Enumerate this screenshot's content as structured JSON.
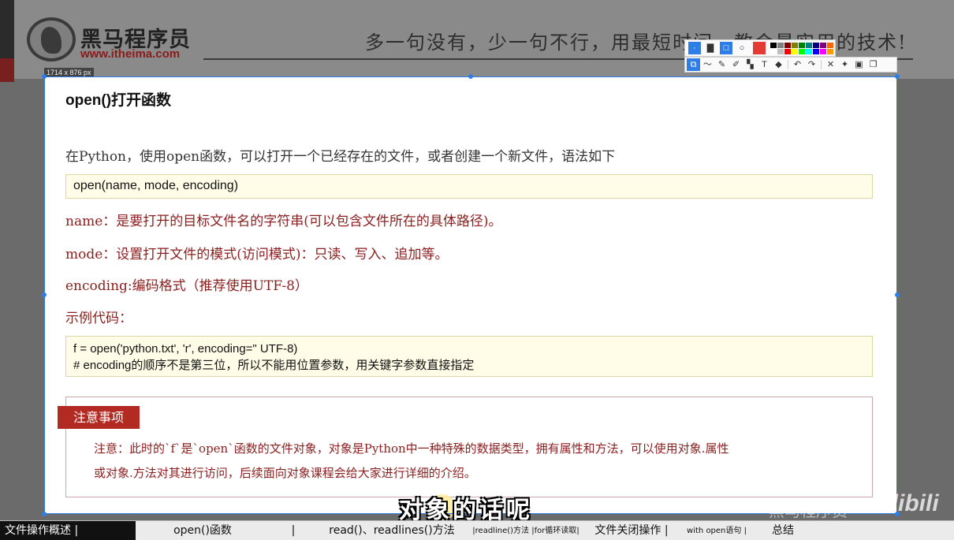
{
  "header": {
    "logo_text": "黑马程序员",
    "logo_url": "www.itheima.com",
    "slogan": "多一句没有，少一句不行，用最短时间，教会最实用的技术!"
  },
  "capture": {
    "dimensions_label": "1714 x 876  px",
    "toolbar_colors": [
      "#000000",
      "#808080",
      "#800000",
      "#808000",
      "#008000",
      "#008080",
      "#000080",
      "#800080",
      "#ff6600",
      "#ffffff",
      "#c0c0c0",
      "#ff0000",
      "#ffff00",
      "#00ff00",
      "#00ffff",
      "#0000ff",
      "#ff00ff",
      "#ff9900"
    ],
    "current_color": "#e53935",
    "selection_color": "#2f7ee8"
  },
  "slide": {
    "title": "open()打开函数",
    "intro": "在Python，使用open函数，可以打开一个已经存在的文件，或者创建一个新文件，语法如下",
    "syntax": "open(name, mode, encoding)",
    "params": [
      "name：是要打开的目标文件名的字符串(可以包含文件所在的具体路径)。",
      "mode：设置打开文件的模式(访问模式)：只读、写入、追加等。",
      "encoding:编码格式（推荐使用UTF-8）"
    ],
    "example_label": "示例代码：",
    "example_code": [
      "f = open('python.txt', 'r', encoding=\" UTF-8)",
      "# encoding的顺序不是第三位，所以不能用位置参数，用关键字参数直接指定"
    ],
    "note_tag": "注意事项",
    "note_lines": [
      "注意：此时的`f`是`open`函数的文件对象，对象是Python中一种特殊的数据类型，拥有属性和方法，可以使用对象.属性",
      "或对象.方法对其进行访问，后续面向对象课程会给大家进行详细的介绍。"
    ],
    "accent_color": "#b22a22"
  },
  "video": {
    "subtitle": "对象的话呢",
    "watermark": "黑马程序员",
    "platform_logo": "bilibili"
  },
  "chapters": [
    {
      "label": "文件操作概述 |",
      "active": true
    },
    {
      "label": "open()函数",
      "active": false
    },
    {
      "label": "|",
      "active": false
    },
    {
      "label": "read()、readlines()方法",
      "active": false
    },
    {
      "label": "|readline()方法 |for循环读取|",
      "active": false,
      "small": true
    },
    {
      "label": "文件关闭操作 |",
      "active": false
    },
    {
      "label": "with open语句 |",
      "active": false,
      "small2": true
    },
    {
      "label": "总结",
      "active": false
    }
  ]
}
